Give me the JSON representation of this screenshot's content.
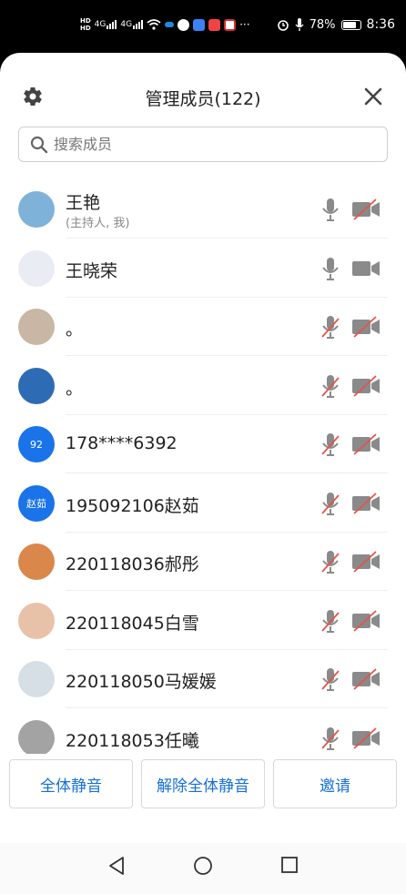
{
  "status_bar": {
    "battery": "78%",
    "time": "8:36",
    "signal1": "4G",
    "signal2": "4G",
    "overflow": "···"
  },
  "header": {
    "title": "管理成员(122)",
    "settings_icon": "gear-icon",
    "close_icon": "close-icon"
  },
  "search": {
    "placeholder": "搜索成员"
  },
  "members": [
    {
      "name": "王艳",
      "sub": "(主持人, 我)",
      "avatar_text": "",
      "avatar_color": "#7fb2d9",
      "mic_muted": false,
      "cam_off": true
    },
    {
      "name": "王晓荣",
      "sub": "",
      "avatar_text": "",
      "avatar_color": "#e9ecf2",
      "mic_muted": false,
      "cam_off": false
    },
    {
      "name": "。",
      "sub": "",
      "avatar_text": "",
      "avatar_color": "#c8b7a5",
      "mic_muted": true,
      "cam_off": true
    },
    {
      "name": "。",
      "sub": "",
      "avatar_text": "",
      "avatar_color": "#2d6bb5",
      "mic_muted": true,
      "cam_off": true
    },
    {
      "name": "178****6392",
      "sub": "",
      "avatar_text": "92",
      "avatar_color": "#1a73e8",
      "mic_muted": true,
      "cam_off": true
    },
    {
      "name": "195092106赵茹",
      "sub": "",
      "avatar_text": "赵茹",
      "avatar_color": "#1a73e8",
      "mic_muted": true,
      "cam_off": true
    },
    {
      "name": "220118036郝彤",
      "sub": "",
      "avatar_text": "",
      "avatar_color": "#d9874a",
      "mic_muted": true,
      "cam_off": true
    },
    {
      "name": "220118045白雪",
      "sub": "",
      "avatar_text": "",
      "avatar_color": "#e8c2a8",
      "mic_muted": true,
      "cam_off": true
    },
    {
      "name": "220118050马媛媛",
      "sub": "",
      "avatar_text": "",
      "avatar_color": "#d6dfe6",
      "mic_muted": true,
      "cam_off": true
    },
    {
      "name": "220118053任曦",
      "sub": "",
      "avatar_text": "",
      "avatar_color": "#a3a3a3",
      "mic_muted": true,
      "cam_off": true
    }
  ],
  "actions": {
    "mute_all": "全体静音",
    "unmute_all": "解除全体静音",
    "invite": "邀请"
  },
  "colors": {
    "accent": "#1670d6",
    "muted_red": "#e0564b",
    "icon_gray": "#8a8a8a"
  }
}
